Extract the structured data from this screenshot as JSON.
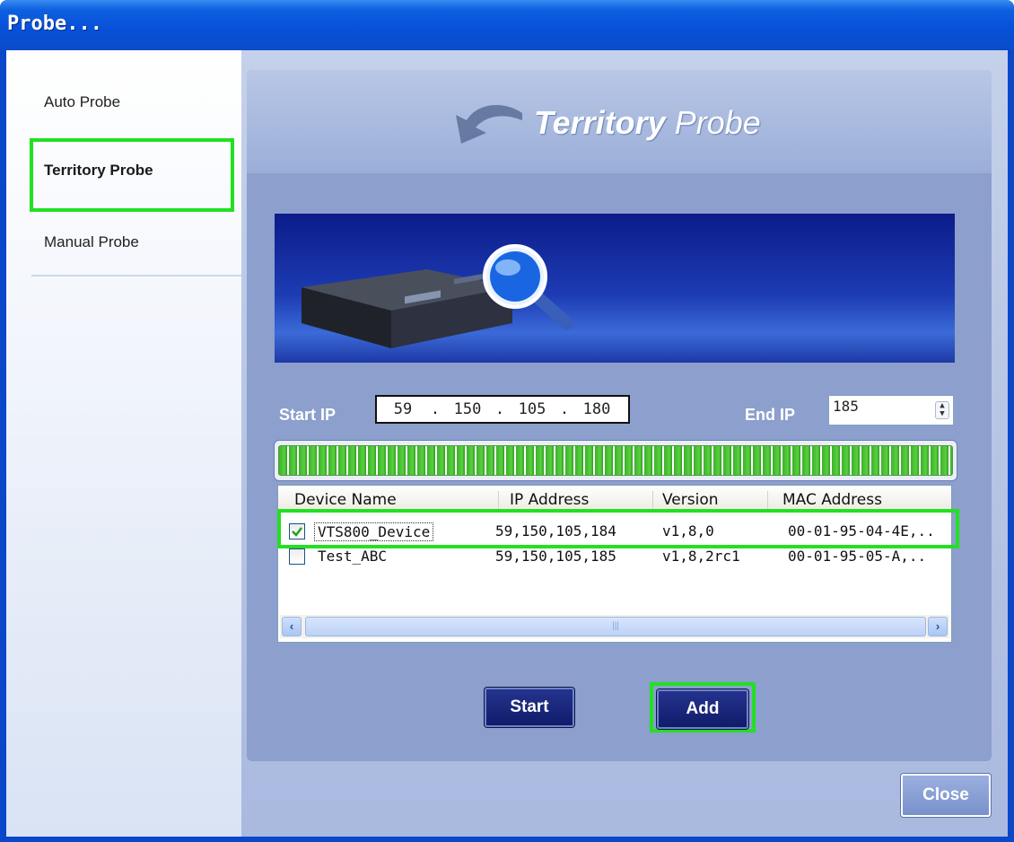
{
  "window": {
    "title": "Probe..."
  },
  "sidebar": {
    "items": [
      {
        "label": "Auto Probe"
      },
      {
        "label": "Territory Probe"
      },
      {
        "label": "Manual Probe"
      }
    ]
  },
  "panel": {
    "title_bold": "Territory",
    "title_rest": " Probe"
  },
  "range": {
    "start_label": "Start IP",
    "start_ip": [
      "59",
      "150",
      "105",
      "180"
    ],
    "end_label": "End IP",
    "end_value": "185"
  },
  "progress": {
    "value": 1.0
  },
  "table": {
    "columns": [
      "Device Name",
      "IP Address",
      "Version",
      "MAC Address"
    ],
    "rows": [
      {
        "checked": true,
        "name": "VTS800_Device",
        "ip": "59,150,105,184",
        "version": "v1,8,0",
        "mac": "00-01-95-04-4E,.."
      },
      {
        "checked": false,
        "name": "Test_ABC",
        "ip": "59,150,105,185",
        "version": "v1,8,2rc1",
        "mac": "00-01-95-05-A,.."
      }
    ]
  },
  "buttons": {
    "start": "Start",
    "add": "Add",
    "close": "Close"
  },
  "icons": {
    "back_arrow": "back-arrow-icon",
    "device": "network-device-icon",
    "magnifier": "magnifier-icon",
    "checkmark": "checkmark-icon",
    "scroll_left": "scroll-left-icon",
    "scroll_right": "scroll-right-icon",
    "spinner": "spinner-icon"
  },
  "colors": {
    "highlight": "#22e022",
    "title_bar": "#0750d8",
    "panel": "#8c9fcd"
  }
}
